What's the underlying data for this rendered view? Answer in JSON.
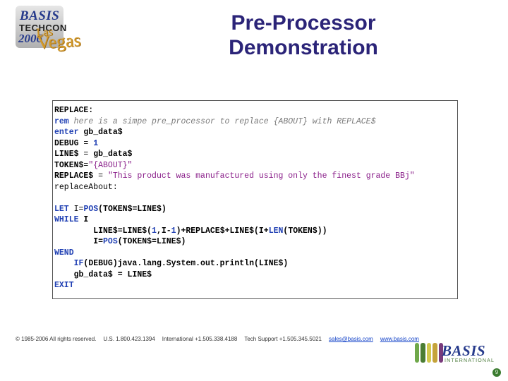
{
  "logoTop": {
    "brand": "BASIS",
    "event": "TECHCON",
    "year": "2006",
    "city_prefix": "Las",
    "city": "Vegas"
  },
  "title": {
    "line1": "Pre-Processor",
    "line2": "Demonstration"
  },
  "code": {
    "l01_label": "REPLACE:",
    "l02_kw": "rem",
    "l02_comment": " here is a simpe pre_processor to replace {ABOUT} with REPLACE$",
    "l03_kw": "enter",
    "l03_var": " gb_data$",
    "l04_lhs": "DEBUG",
    "l04_eq": " = ",
    "l04_rhs": "1",
    "l05_lhs": "LINE$",
    "l05_eq": " = ",
    "l05_rhs": "gb_data$",
    "l06_lhs": "TOKEN$",
    "l06_eq": "=",
    "l06_rhs": "\"{ABOUT}\"",
    "l07_lhs": "REPLACE$",
    "l07_eq": " = ",
    "l07_rhs": "\"This product was manufactured using only the finest grade BBj\"",
    "l08": "replaceAbout:",
    "l09_kw": "LET",
    "l09_rest_a": " I=",
    "l09_fn": "POS",
    "l09_rest_b": "(TOKEN$=LINE$)",
    "l10_kw": "WHILE",
    "l10_rest": " I",
    "l11_a": "LINE$=LINE$(",
    "l11_b": "1",
    "l11_c": ",I-",
    "l11_d": "1",
    "l11_e": ")+REPLACE$+LINE$(I+",
    "l11_fn": "LEN",
    "l11_f": "(TOKEN$))",
    "l12_a": "I=",
    "l12_fn": "POS",
    "l12_b": "(TOKEN$=LINE$)",
    "l13_kw": "WEND",
    "l14_kw": "IF",
    "l14_rest": "(DEBUG)java.lang.System.out.",
    "l14_mthd": "println",
    "l14_tail": "(LINE$)",
    "l15": "gb_data$ = LINE$",
    "l16_kw": "EXIT"
  },
  "footer": {
    "copyright": "© 1985-2006  All rights reserved.",
    "us": "U.S. 1.800.423.1394",
    "intl": "International +1.505.338.4188",
    "tech": "Tech Support +1.505.345.5021",
    "email": "sales@basis.com",
    "site": "www.basis.com"
  },
  "logoBot": {
    "brand": "BASIS",
    "sub": "INTERNATIONAL",
    "stripeColors": [
      "#6fa84a",
      "#4b7d33",
      "#d2c94e",
      "#c5a33a",
      "#793b7c"
    ]
  },
  "pageNum": "9"
}
